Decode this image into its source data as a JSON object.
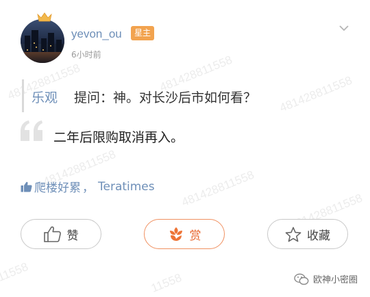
{
  "post": {
    "username": "yevon_ou",
    "badge": "星主",
    "time": "6小时前"
  },
  "question": {
    "asker": "乐观",
    "text": "提问：神。对长沙后市如何看？"
  },
  "answer": {
    "text": "二年后限购取消再入。"
  },
  "likes": {
    "users": [
      "爬楼好累",
      "Teratimes"
    ],
    "separator": "，"
  },
  "actions": {
    "like_label": "赞",
    "reward_label": "赏",
    "favorite_label": "收藏"
  },
  "watermark": {
    "text_full": "481428811558",
    "text_partial": "11558"
  },
  "footer": {
    "brand": "欧神小密圈"
  },
  "colors": {
    "link_blue": "#6e8fb8",
    "badge_orange": "#f2a34f",
    "reward_orange": "#e7652c",
    "crown_yellow": "#f2b84b"
  },
  "icons": {
    "crown": "crown-icon",
    "more": "chevron-down-icon",
    "quote": "quote-mark-icon",
    "like": "thumbs-up-icon",
    "reward": "flower-icon",
    "favorite": "star-icon",
    "brand": "wechat-icon"
  }
}
